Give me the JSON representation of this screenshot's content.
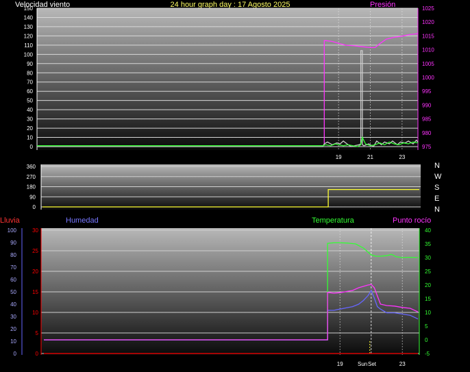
{
  "header": {
    "wind_label": "Velocidad viento",
    "graph_title": "24 hour graph day : 17 Agosto 2025",
    "pressure_label": "Presión",
    "rain_label": "Lluvia",
    "humidity_label": "Humedad",
    "temperature_label": "Temperatura",
    "dewpoint_label": "Punto rocío",
    "sun_label": "Sun",
    "sunset_label": "Set"
  },
  "compass": {
    "letters": [
      "N",
      "W",
      "S",
      "E",
      "N"
    ]
  },
  "colors": {
    "wind_axis": "#ffffff",
    "pressure": "#ff33ff",
    "rain": "#ff0000",
    "humidity": "#6666ff",
    "temperature": "#33ff33",
    "dewpoint": "#ff33ff",
    "direction": "#ffff33",
    "gust": "#ffffff"
  },
  "chart_data": [
    {
      "type": "line",
      "name": "wind-pressure",
      "xlim": [
        0,
        24
      ],
      "x_ticks": [
        {
          "x": 19,
          "label": "19"
        },
        {
          "x": 21,
          "label": "21"
        },
        {
          "x": 23,
          "label": "23"
        }
      ],
      "ylim_left": [
        0,
        150
      ],
      "yticks_left": [
        0,
        10,
        20,
        30,
        40,
        50,
        60,
        70,
        80,
        90,
        100,
        110,
        120,
        130,
        140,
        150
      ],
      "ylim_right": [
        975,
        1025
      ],
      "yticks_right": [
        975,
        980,
        985,
        990,
        995,
        1000,
        1005,
        1010,
        1015,
        1020,
        1025
      ],
      "series": [
        {
          "name": "Presión",
          "axis": "right",
          "color": "#ff33ff",
          "x": [
            18.1,
            18.1,
            18.2,
            18.6,
            19.0,
            19.5,
            20.0,
            20.5,
            21.0,
            21.3,
            21.6,
            22.0,
            22.5,
            23.0,
            23.5,
            24.0
          ],
          "y": [
            975.5,
            1013.3,
            1013.3,
            1013.0,
            1012.3,
            1011.6,
            1011.4,
            1011.1,
            1010.8,
            1010.8,
            1012.2,
            1013.8,
            1014.5,
            1014.9,
            1015.5,
            1015.8
          ]
        },
        {
          "axis": "left",
          "color": "#cccccc",
          "x": [
            0,
            18.0,
            18.1,
            18.3,
            18.6,
            18.9,
            19.1,
            19.3,
            19.6,
            19.8,
            20.0,
            20.3,
            20.4,
            20.4,
            20.5,
            20.5,
            20.6,
            20.9,
            21.2,
            21.4,
            21.7,
            21.9,
            22.2,
            22.4,
            22.7,
            22.9,
            23.2,
            23.4,
            23.7,
            23.9,
            24.0
          ],
          "y": [
            0,
            0,
            3,
            5,
            2,
            4,
            3,
            6,
            2,
            0,
            1,
            2,
            3,
            104,
            104,
            2,
            1,
            3,
            0,
            6,
            2,
            5,
            3,
            6,
            2,
            5,
            4,
            6,
            3,
            7,
            5
          ]
        },
        {
          "axis": "left",
          "color": "#33ff33",
          "x": [
            0,
            18.0,
            18.2,
            18.5,
            18.8,
            19.0,
            19.3,
            19.6,
            19.9,
            20.2,
            20.4,
            20.5,
            20.7,
            21.0,
            21.3,
            21.6,
            21.9,
            22.2,
            22.5,
            22.8,
            23.1,
            23.4,
            23.7,
            24.0
          ],
          "y": [
            1,
            1,
            2,
            1,
            3,
            2,
            1,
            2,
            1,
            0,
            2,
            10,
            3,
            1,
            2,
            4,
            2,
            5,
            3,
            2,
            4,
            3,
            5,
            4
          ]
        }
      ]
    },
    {
      "type": "line",
      "name": "wind-direction",
      "xlim": [
        0,
        24
      ],
      "ylim": [
        0,
        360
      ],
      "yticks": [
        0,
        90,
        180,
        270,
        360
      ],
      "series": [
        {
          "axis": "left",
          "color": "#ffff33",
          "x": [
            0,
            18.2,
            18.2,
            24.0
          ],
          "y": [
            0,
            0,
            155,
            155
          ]
        }
      ]
    },
    {
      "type": "line",
      "name": "temp-hum-rain",
      "xlim": [
        0,
        24
      ],
      "x_ticks": [
        {
          "x": 19,
          "label": "19"
        },
        {
          "x": 23,
          "label": "23"
        }
      ],
      "ylim_rain": [
        0,
        30
      ],
      "yticks_rain": [
        0,
        5,
        10,
        15,
        20,
        25,
        30
      ],
      "ylim_hum": [
        0,
        100
      ],
      "yticks_hum": [
        0,
        10,
        20,
        30,
        40,
        50,
        60,
        70,
        80,
        90,
        100
      ],
      "ylim_temp": [
        -5,
        40
      ],
      "yticks_temp": [
        -5,
        0,
        5,
        10,
        15,
        20,
        25,
        30,
        35,
        40
      ],
      "sunset_hour": 21.0,
      "series": [
        {
          "name": "Lluvia",
          "axis": "rain",
          "color": "#ff0000",
          "x": [
            0,
            24
          ],
          "y": [
            0,
            0
          ]
        },
        {
          "name": "Humedad",
          "axis": "hum",
          "color": "#6666ff",
          "x": [
            0,
            18.2,
            18.2,
            18.6,
            19.0,
            19.4,
            19.8,
            20.2,
            20.5,
            20.8,
            21.0,
            21.2,
            21.4,
            21.6,
            22.0,
            22.5,
            23.0,
            23.5,
            24.0
          ],
          "y": [
            11,
            11,
            35,
            35,
            36,
            37,
            38,
            40,
            43,
            47,
            51,
            45,
            38,
            36,
            33,
            33,
            32,
            31,
            28
          ]
        },
        {
          "name": "Temperatura",
          "axis": "temp",
          "color": "#33ff33",
          "x": [
            0,
            18.2,
            18.2,
            18.6,
            19.0,
            19.5,
            20.0,
            20.5,
            21.0,
            21.3,
            21.6,
            22.0,
            22.3,
            22.6,
            23.0,
            23.5,
            24.0
          ],
          "y": [
            0,
            0,
            35.2,
            35.4,
            35.4,
            35.3,
            35.0,
            33.5,
            31.0,
            30.5,
            30.5,
            30.7,
            31.2,
            30.3,
            30.0,
            30.1,
            30.0
          ]
        },
        {
          "name": "Punto rocío",
          "axis": "temp",
          "color": "#ff33ff",
          "x": [
            0,
            18.2,
            18.2,
            18.6,
            19.0,
            19.4,
            19.8,
            20.2,
            20.5,
            20.8,
            21.0,
            21.2,
            21.4,
            21.6,
            22.0,
            22.5,
            23.0,
            23.5,
            24.0
          ],
          "y": [
            0,
            0,
            17.3,
            17.0,
            17.2,
            17.6,
            18.0,
            19.0,
            19.5,
            20.0,
            20.2,
            19.0,
            16.0,
            13.0,
            12.5,
            12.3,
            11.8,
            11.5,
            10.2
          ]
        }
      ]
    }
  ]
}
